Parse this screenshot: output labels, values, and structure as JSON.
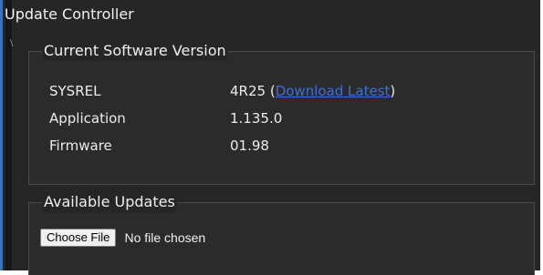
{
  "window": {
    "title": "Update Controller"
  },
  "current_version": {
    "legend": "Current Software Version",
    "rows": [
      {
        "label": "SYSREL",
        "value": "4R25",
        "link_open": "(",
        "link_text": "Download Latest",
        "link_close": ")"
      },
      {
        "label": "Application",
        "value": "1.135.0"
      },
      {
        "label": "Firmware",
        "value": "01.98"
      }
    ]
  },
  "updates": {
    "legend": "Available Updates",
    "choose_file_label": "Choose File",
    "file_status": "No file chosen"
  },
  "colors": {
    "background": "#262626",
    "accent_border": "#3c72b8",
    "link": "#3f6fd8"
  }
}
